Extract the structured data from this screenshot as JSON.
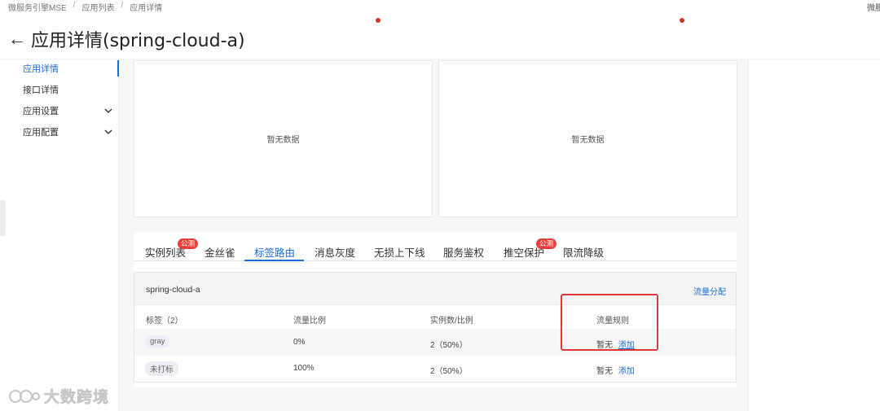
{
  "breadcrumb": [
    "微服务引擎MSE",
    "应用列表",
    "应用详情"
  ],
  "top_right_text": "微服务",
  "header": {
    "back_glyph": "←",
    "title": "应用详情(spring-cloud-a)"
  },
  "sidebar": {
    "items": [
      {
        "label": "应用详情",
        "active": true
      },
      {
        "label": "接口详情"
      },
      {
        "label": "应用设置",
        "chevron": "chevron-down-icon"
      },
      {
        "label": "应用配置",
        "chevron": "chevron-down-icon"
      }
    ]
  },
  "cards": [
    {
      "empty_text": "暂无数据"
    },
    {
      "empty_text": "暂无数据"
    }
  ],
  "tabs": [
    {
      "label": "实例列表",
      "badge": "公测"
    },
    {
      "label": "金丝雀"
    },
    {
      "label": "标签路由",
      "active": true
    },
    {
      "label": "消息灰度"
    },
    {
      "label": "无损上下线"
    },
    {
      "label": "服务鉴权"
    },
    {
      "label": "推空保护",
      "badge": "公测"
    },
    {
      "label": "限流降级"
    }
  ],
  "route": {
    "app_name": "spring-cloud-a",
    "flow_link": "流量分配",
    "columns": [
      "标签（2）",
      "流量比例",
      "实例数/比例",
      "流量规则"
    ],
    "rows": [
      {
        "tag": "gray",
        "ratio": "0%",
        "instances": "2（50%）",
        "rule_none": "暂无",
        "rule_add": "添加"
      },
      {
        "tag": "未打标",
        "ratio": "100%",
        "instances": "2（50%）",
        "rule_none": "暂无",
        "rule_add": "添加"
      }
    ]
  },
  "watermark": {
    "text": "大数跨境"
  },
  "colors": {
    "primary": "#1b6ed6",
    "badge": "#e8403a",
    "highlight": "#e0373c"
  }
}
